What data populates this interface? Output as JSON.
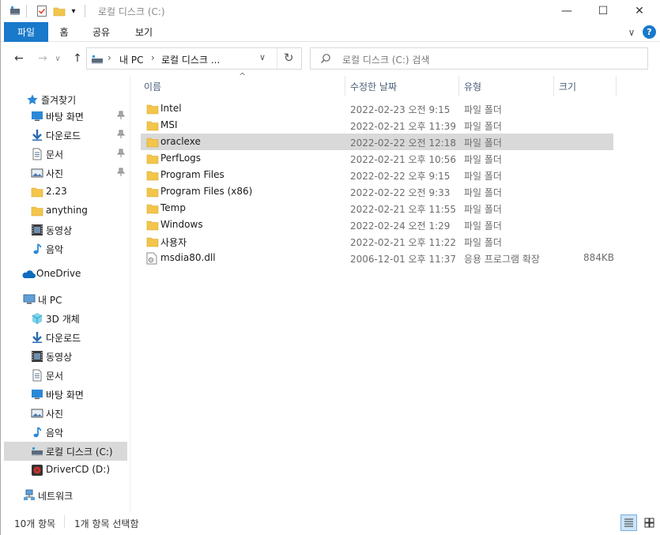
{
  "window": {
    "title": "로컬 디스크 (C:)",
    "controls": {
      "minimize": "—",
      "maximize": "☐",
      "close": "✕"
    },
    "qa_icons": [
      "properties-icon",
      "checklist-icon",
      "new-folder-icon",
      "quick-access-dropdown-icon"
    ]
  },
  "ribbon": {
    "tabs": [
      {
        "label": "파일",
        "active": true
      },
      {
        "label": "홈"
      },
      {
        "label": "공유"
      },
      {
        "label": "보기"
      }
    ],
    "expand": "∨",
    "help": "?"
  },
  "nav": {
    "back": "←",
    "forward": "→",
    "recent": "∨",
    "up": "↑",
    "breadcrumb": [
      "내 PC",
      "로컬 디스크 ..."
    ],
    "separator": "›",
    "dropdown": "∨",
    "refresh": "↻"
  },
  "search": {
    "placeholder": "로컬 디스크 (C:) 검색"
  },
  "sidebar": {
    "items": [
      {
        "label": "즐겨찾기",
        "icon": "star-icon",
        "pinned": false
      },
      {
        "label": "바탕 화면",
        "icon": "desktop-icon",
        "pinned": true
      },
      {
        "label": "다운로드",
        "icon": "download-icon",
        "pinned": true
      },
      {
        "label": "문서",
        "icon": "document-icon",
        "pinned": true
      },
      {
        "label": "사진",
        "icon": "pictures-icon",
        "pinned": true
      },
      {
        "label": "2.23",
        "icon": "folder-icon",
        "pinned": false
      },
      {
        "label": "anything",
        "icon": "folder-icon",
        "pinned": false
      },
      {
        "label": "동영상",
        "icon": "video-icon",
        "pinned": false
      },
      {
        "label": "음악",
        "icon": "music-icon",
        "pinned": false
      },
      {
        "label": "OneDrive",
        "icon": "cloud-icon",
        "pinned": false
      },
      {
        "label": "내 PC",
        "icon": "pc-icon",
        "pinned": false
      },
      {
        "label": "3D 개체",
        "icon": "3d-objects-icon",
        "pinned": false
      },
      {
        "label": "다운로드",
        "icon": "download-icon",
        "pinned": false
      },
      {
        "label": "동영상",
        "icon": "video-icon",
        "pinned": false
      },
      {
        "label": "문서",
        "icon": "document-icon",
        "pinned": false
      },
      {
        "label": "바탕 화면",
        "icon": "desktop-icon",
        "pinned": false
      },
      {
        "label": "사진",
        "icon": "pictures-icon",
        "pinned": false
      },
      {
        "label": "음악",
        "icon": "music-icon",
        "pinned": false
      },
      {
        "label": "로컬 디스크 (C:)",
        "icon": "drive-icon",
        "pinned": false,
        "selected": true
      },
      {
        "label": "DriverCD (D:)",
        "icon": "cd-drive-icon",
        "pinned": false
      },
      {
        "label": "네트워크",
        "icon": "network-icon",
        "pinned": false
      }
    ],
    "pin_glyph": "📌"
  },
  "columns": {
    "name": "이름",
    "date": "수정한 날짜",
    "type": "유형",
    "size": "크기",
    "sort_indicator": "^"
  },
  "files": [
    {
      "name": "Intel",
      "date": "2022-02-23 오전 9:15",
      "type": "파일 폴더",
      "size": "",
      "icon": "folder-icon"
    },
    {
      "name": "MSI",
      "date": "2022-02-21 오후 11:39",
      "type": "파일 폴더",
      "size": "",
      "icon": "folder-icon"
    },
    {
      "name": "oraclexe",
      "date": "2022-02-22 오전 12:18",
      "type": "파일 폴더",
      "size": "",
      "icon": "folder-icon",
      "selected": true
    },
    {
      "name": "PerfLogs",
      "date": "2022-02-21 오후 10:56",
      "type": "파일 폴더",
      "size": "",
      "icon": "folder-icon"
    },
    {
      "name": "Program Files",
      "date": "2022-02-22 오후 9:15",
      "type": "파일 폴더",
      "size": "",
      "icon": "folder-icon"
    },
    {
      "name": "Program Files (x86)",
      "date": "2022-02-22 오전 9:33",
      "type": "파일 폴더",
      "size": "",
      "icon": "folder-icon"
    },
    {
      "name": "Temp",
      "date": "2022-02-21 오후 11:55",
      "type": "파일 폴더",
      "size": "",
      "icon": "folder-icon"
    },
    {
      "name": "Windows",
      "date": "2022-02-24 오전 1:29",
      "type": "파일 폴더",
      "size": "",
      "icon": "folder-icon"
    },
    {
      "name": "사용자",
      "date": "2022-02-21 오후 11:22",
      "type": "파일 폴더",
      "size": "",
      "icon": "folder-icon"
    },
    {
      "name": "msdia80.dll",
      "date": "2006-12-01 오후 11:37",
      "type": "응용 프로그램 확장",
      "size": "884KB",
      "icon": "dll-file-icon"
    }
  ],
  "status": {
    "count": "10개 항목",
    "selection": "1개 항목 선택함"
  },
  "colors": {
    "accent": "#1979ca",
    "folder": "#f3c54b",
    "selection": "#d9d9d9",
    "header_text": "#4c607a"
  }
}
